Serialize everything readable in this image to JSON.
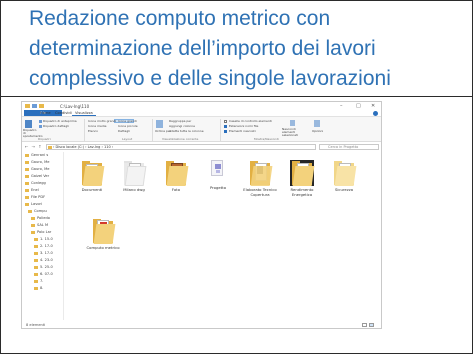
{
  "slide": {
    "title_lines": [
      "Redazione computo metrico con",
      "determinazione dell’importo dei lavori",
      "complessivo e delle singole lavorazioni"
    ]
  },
  "explorer": {
    "window_title": "C:\\Lav-Ing\\110",
    "window_controls": {
      "minimize": "–",
      "maximize": "□",
      "close": "✕"
    },
    "menu_tabs": [
      "File",
      "Home",
      "Condividi",
      "Visualizza"
    ],
    "ribbon": {
      "panes": [
        "Riquadro di spostamento",
        "Riquadro di anteprima",
        "Riquadro dettagli"
      ],
      "layout": [
        "Icone molto grandi",
        "Icone grandi",
        "Icone medie",
        "Icone piccole",
        "Elenco",
        "Dettagli",
        "Riquadri",
        "Contenuto"
      ],
      "sort_label": "Ordina per",
      "current_view": [
        "Raggruppa per",
        "Aggiungi colonne",
        "Adatta tutte le colonne"
      ],
      "show_hide": [
        {
          "label": "Caselle di controllo elementi",
          "checked": false
        },
        {
          "label": "Estensioni nomi file",
          "checked": true
        },
        {
          "label": "Elementi nascosti",
          "checked": true
        }
      ],
      "hide_selected": "Nascondi elementi selezionati",
      "options": "Opzioni",
      "groups": [
        "Riquadri",
        "Layout",
        "Visualizzazione corrente",
        "Mostra/Nascondi"
      ]
    },
    "address": {
      "nav_arrows": "← → ↑",
      "path": "› Disco locale (C:) › Lav-Ing › 110 ›",
      "search_placeholder": "Cerca in Progetto"
    },
    "nav_items": [
      {
        "label": "Genrani s"
      },
      {
        "label": "Gauro, Me"
      },
      {
        "label": "Gauro, Me"
      },
      {
        "label": "Gaizel Ver"
      },
      {
        "label": "Conlegg"
      },
      {
        "label": "Enel"
      },
      {
        "label": "File PDF"
      },
      {
        "label": "Lavori"
      },
      {
        "label": "Compu"
      },
      {
        "label": "Poliedo"
      },
      {
        "label": "SAL M"
      },
      {
        "label": "Polo Lar"
      },
      {
        "label": "1. 15-0"
      },
      {
        "label": "2. 17-0"
      },
      {
        "label": "3. 17-0"
      },
      {
        "label": "4. 23-0"
      },
      {
        "label": "5. 25-0"
      },
      {
        "label": "6. 07-0"
      },
      {
        "label": "7."
      },
      {
        "label": "8."
      }
    ],
    "files": [
      {
        "label": "Documenti"
      },
      {
        "label": "Milano dwg"
      },
      {
        "label": "Foto"
      },
      {
        "label": "Progetto"
      },
      {
        "label": "Elaborato Tecnico Copertura"
      },
      {
        "label": "Rendimento Energetico"
      },
      {
        "label": "Sicurezza"
      },
      {
        "label": "Computo metrico"
      }
    ],
    "status": {
      "items_count": "8 elementi"
    }
  },
  "colors": {
    "title_text": "#2f72b4",
    "folder": "#f3d27c",
    "folder_dark": "#e2b043",
    "accent": "#2a6fbd",
    "border": "#2b2b2b"
  }
}
